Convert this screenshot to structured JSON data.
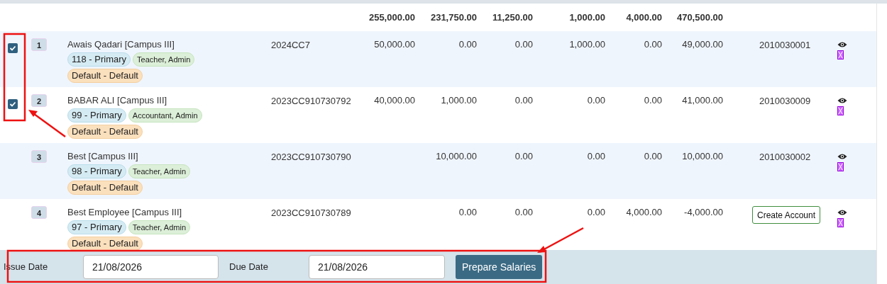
{
  "totals": [
    "255,000.00",
    "231,750.00",
    "11,250.00",
    "1,000.00",
    "4,000.00",
    "470,500.00"
  ],
  "rows": [
    {
      "checked": true,
      "index": "1",
      "name": "Awais Qadari [Campus III]",
      "tags": [
        "118 - Primary",
        "Teacher,  Admin",
        "Default - Default"
      ],
      "code": "2024CC7",
      "amounts": {
        "column_1": "50,000.00",
        "column_2": "0.00",
        "column_3": "0.00",
        "column_4": "1,000.00",
        "column_5": "0.00",
        "column_6": "49,000.00"
      },
      "account": {
        "kind": "number",
        "text": "2010030001"
      }
    },
    {
      "checked": true,
      "index": "2",
      "name": "BABAR ALI [Campus III]",
      "tags": [
        "99 - Primary",
        "Accountant,  Admin",
        "Default - Default"
      ],
      "code": "2023CC910730792",
      "amounts": {
        "column_1": "40,000.00",
        "column_2": "1,000.00",
        "column_3": "0.00",
        "column_4": "0.00",
        "column_5": "0.00",
        "column_6": "41,000.00"
      },
      "account": {
        "kind": "number",
        "text": "2010030009"
      }
    },
    {
      "checked": false,
      "index": "3",
      "name": "Best [Campus III]",
      "tags": [
        "98 - Primary",
        "Teacher,  Admin",
        "Default - Default"
      ],
      "code": "2023CC910730790",
      "amounts": {
        "column_2": "10,000.00",
        "column_3": "0.00",
        "column_4": "0.00",
        "column_5": "0.00",
        "column_6": "10,000.00"
      },
      "account": {
        "kind": "number",
        "text": "2010030002"
      }
    },
    {
      "checked": false,
      "index": "4",
      "name": "Best Employee [Campus III]",
      "tags": [
        "97 - Primary",
        "Teacher,  Admin",
        "Default - Default"
      ],
      "code": "2023CC910730789",
      "amounts": {
        "column_2": "0.00",
        "column_3": "0.00",
        "column_4": "0.00",
        "column_5": "4,000.00",
        "column_6": "-4,000.00"
      },
      "account": {
        "kind": "button",
        "text": "Create Account"
      }
    }
  ],
  "footer": {
    "issue_label": "Issue Date",
    "issue_value": "21/08/2026",
    "due_label": "Due Date",
    "due_value": "21/08/2026",
    "button": "Prepare Salaries"
  }
}
